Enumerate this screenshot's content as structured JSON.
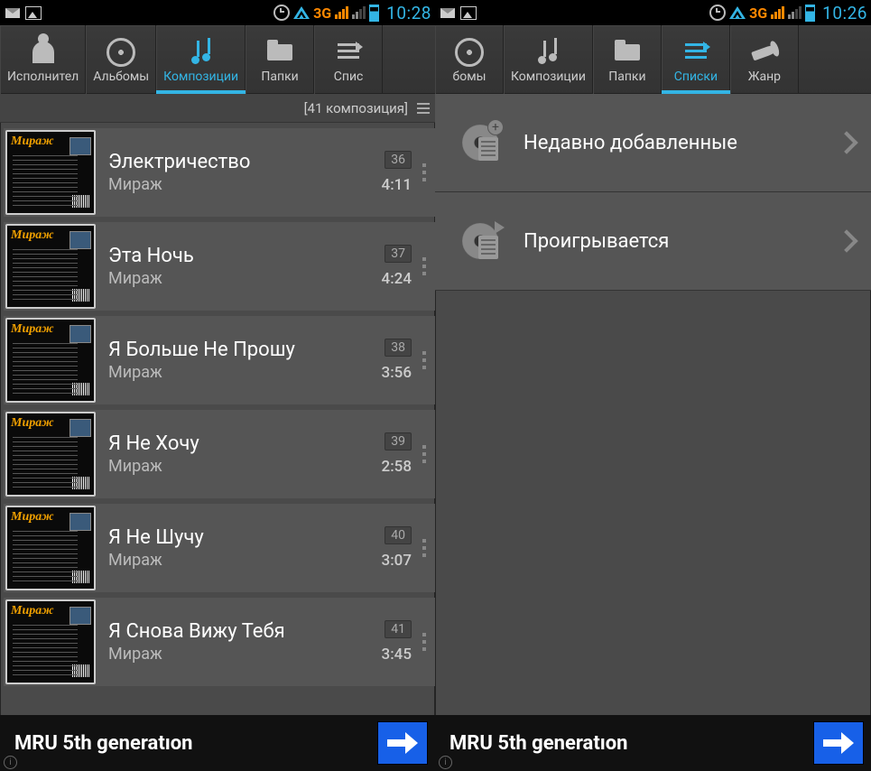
{
  "left": {
    "status": {
      "time": "10:28",
      "net": "3G"
    },
    "tabs": [
      {
        "label": "Исполнител",
        "icon": "artist",
        "active": false
      },
      {
        "label": "Альбомы",
        "icon": "album",
        "active": false
      },
      {
        "label": "Композиции",
        "icon": "song",
        "active": true
      },
      {
        "label": "Папки",
        "icon": "folder",
        "active": false
      },
      {
        "label": "Спис",
        "icon": "list",
        "active": false
      }
    ],
    "count_label": "[41 композиция]",
    "album_text": "Мираж",
    "tracks": [
      {
        "title": "Электричество",
        "artist": "Мираж",
        "num": "36",
        "dur": "4:11"
      },
      {
        "title": "Эта Ночь",
        "artist": "Мираж",
        "num": "37",
        "dur": "4:24"
      },
      {
        "title": "Я Больше Не Прошу",
        "artist": "Мираж",
        "num": "38",
        "dur": "3:56"
      },
      {
        "title": "Я Не Хочу",
        "artist": "Мираж",
        "num": "39",
        "dur": "2:58"
      },
      {
        "title": "Я Не Шучу",
        "artist": "Мираж",
        "num": "40",
        "dur": "3:07"
      },
      {
        "title": "Я Снова Вижу Тебя",
        "artist": "Мираж",
        "num": "41",
        "dur": "3:45"
      }
    ],
    "bottom_title": "MRU 5th generatıon"
  },
  "right": {
    "status": {
      "time": "10:26",
      "net": "3G"
    },
    "tabs": [
      {
        "label": "бомы",
        "icon": "album",
        "active": false
      },
      {
        "label": "Композиции",
        "icon": "song",
        "active": false
      },
      {
        "label": "Папки",
        "icon": "folder",
        "active": false
      },
      {
        "label": "Списки",
        "icon": "list",
        "active": true
      },
      {
        "label": "Жанр",
        "icon": "genre",
        "active": false
      }
    ],
    "playlists": [
      {
        "label": "Недавно добавленные",
        "kind": "add"
      },
      {
        "label": "Проигрывается",
        "kind": "play"
      }
    ],
    "bottom_title": "MRU 5th generatıon"
  }
}
